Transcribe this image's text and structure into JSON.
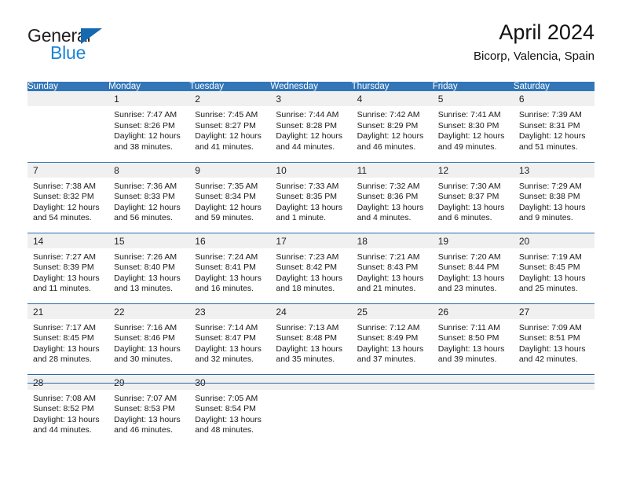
{
  "brand": {
    "name_part1": "General",
    "name_part2": "Blue",
    "triangle_color": "#1469b0",
    "blue_text_color": "#1b84d6"
  },
  "header": {
    "title": "April 2024",
    "subtitle": "Bicorp, Valencia, Spain"
  },
  "theme": {
    "header_bg": "#3276b8",
    "rule_color": "#2b6cad",
    "daynum_band_bg": "#f0f0f0"
  },
  "weekdays": [
    "Sunday",
    "Monday",
    "Tuesday",
    "Wednesday",
    "Thursday",
    "Friday",
    "Saturday"
  ],
  "labels": {
    "sunrise_prefix": "Sunrise:",
    "sunset_prefix": "Sunset:",
    "daylight_prefix": "Daylight:"
  },
  "weeks": [
    [
      {
        "day": "",
        "sunrise": "",
        "sunset": "",
        "daylight_line1": "",
        "daylight_line2": ""
      },
      {
        "day": "1",
        "sunrise": "Sunrise: 7:47 AM",
        "sunset": "Sunset: 8:26 PM",
        "daylight_line1": "Daylight: 12 hours",
        "daylight_line2": "and 38 minutes."
      },
      {
        "day": "2",
        "sunrise": "Sunrise: 7:45 AM",
        "sunset": "Sunset: 8:27 PM",
        "daylight_line1": "Daylight: 12 hours",
        "daylight_line2": "and 41 minutes."
      },
      {
        "day": "3",
        "sunrise": "Sunrise: 7:44 AM",
        "sunset": "Sunset: 8:28 PM",
        "daylight_line1": "Daylight: 12 hours",
        "daylight_line2": "and 44 minutes."
      },
      {
        "day": "4",
        "sunrise": "Sunrise: 7:42 AM",
        "sunset": "Sunset: 8:29 PM",
        "daylight_line1": "Daylight: 12 hours",
        "daylight_line2": "and 46 minutes."
      },
      {
        "day": "5",
        "sunrise": "Sunrise: 7:41 AM",
        "sunset": "Sunset: 8:30 PM",
        "daylight_line1": "Daylight: 12 hours",
        "daylight_line2": "and 49 minutes."
      },
      {
        "day": "6",
        "sunrise": "Sunrise: 7:39 AM",
        "sunset": "Sunset: 8:31 PM",
        "daylight_line1": "Daylight: 12 hours",
        "daylight_line2": "and 51 minutes."
      }
    ],
    [
      {
        "day": "7",
        "sunrise": "Sunrise: 7:38 AM",
        "sunset": "Sunset: 8:32 PM",
        "daylight_line1": "Daylight: 12 hours",
        "daylight_line2": "and 54 minutes."
      },
      {
        "day": "8",
        "sunrise": "Sunrise: 7:36 AM",
        "sunset": "Sunset: 8:33 PM",
        "daylight_line1": "Daylight: 12 hours",
        "daylight_line2": "and 56 minutes."
      },
      {
        "day": "9",
        "sunrise": "Sunrise: 7:35 AM",
        "sunset": "Sunset: 8:34 PM",
        "daylight_line1": "Daylight: 12 hours",
        "daylight_line2": "and 59 minutes."
      },
      {
        "day": "10",
        "sunrise": "Sunrise: 7:33 AM",
        "sunset": "Sunset: 8:35 PM",
        "daylight_line1": "Daylight: 13 hours",
        "daylight_line2": "and 1 minute."
      },
      {
        "day": "11",
        "sunrise": "Sunrise: 7:32 AM",
        "sunset": "Sunset: 8:36 PM",
        "daylight_line1": "Daylight: 13 hours",
        "daylight_line2": "and 4 minutes."
      },
      {
        "day": "12",
        "sunrise": "Sunrise: 7:30 AM",
        "sunset": "Sunset: 8:37 PM",
        "daylight_line1": "Daylight: 13 hours",
        "daylight_line2": "and 6 minutes."
      },
      {
        "day": "13",
        "sunrise": "Sunrise: 7:29 AM",
        "sunset": "Sunset: 8:38 PM",
        "daylight_line1": "Daylight: 13 hours",
        "daylight_line2": "and 9 minutes."
      }
    ],
    [
      {
        "day": "14",
        "sunrise": "Sunrise: 7:27 AM",
        "sunset": "Sunset: 8:39 PM",
        "daylight_line1": "Daylight: 13 hours",
        "daylight_line2": "and 11 minutes."
      },
      {
        "day": "15",
        "sunrise": "Sunrise: 7:26 AM",
        "sunset": "Sunset: 8:40 PM",
        "daylight_line1": "Daylight: 13 hours",
        "daylight_line2": "and 13 minutes."
      },
      {
        "day": "16",
        "sunrise": "Sunrise: 7:24 AM",
        "sunset": "Sunset: 8:41 PM",
        "daylight_line1": "Daylight: 13 hours",
        "daylight_line2": "and 16 minutes."
      },
      {
        "day": "17",
        "sunrise": "Sunrise: 7:23 AM",
        "sunset": "Sunset: 8:42 PM",
        "daylight_line1": "Daylight: 13 hours",
        "daylight_line2": "and 18 minutes."
      },
      {
        "day": "18",
        "sunrise": "Sunrise: 7:21 AM",
        "sunset": "Sunset: 8:43 PM",
        "daylight_line1": "Daylight: 13 hours",
        "daylight_line2": "and 21 minutes."
      },
      {
        "day": "19",
        "sunrise": "Sunrise: 7:20 AM",
        "sunset": "Sunset: 8:44 PM",
        "daylight_line1": "Daylight: 13 hours",
        "daylight_line2": "and 23 minutes."
      },
      {
        "day": "20",
        "sunrise": "Sunrise: 7:19 AM",
        "sunset": "Sunset: 8:45 PM",
        "daylight_line1": "Daylight: 13 hours",
        "daylight_line2": "and 25 minutes."
      }
    ],
    [
      {
        "day": "21",
        "sunrise": "Sunrise: 7:17 AM",
        "sunset": "Sunset: 8:45 PM",
        "daylight_line1": "Daylight: 13 hours",
        "daylight_line2": "and 28 minutes."
      },
      {
        "day": "22",
        "sunrise": "Sunrise: 7:16 AM",
        "sunset": "Sunset: 8:46 PM",
        "daylight_line1": "Daylight: 13 hours",
        "daylight_line2": "and 30 minutes."
      },
      {
        "day": "23",
        "sunrise": "Sunrise: 7:14 AM",
        "sunset": "Sunset: 8:47 PM",
        "daylight_line1": "Daylight: 13 hours",
        "daylight_line2": "and 32 minutes."
      },
      {
        "day": "24",
        "sunrise": "Sunrise: 7:13 AM",
        "sunset": "Sunset: 8:48 PM",
        "daylight_line1": "Daylight: 13 hours",
        "daylight_line2": "and 35 minutes."
      },
      {
        "day": "25",
        "sunrise": "Sunrise: 7:12 AM",
        "sunset": "Sunset: 8:49 PM",
        "daylight_line1": "Daylight: 13 hours",
        "daylight_line2": "and 37 minutes."
      },
      {
        "day": "26",
        "sunrise": "Sunrise: 7:11 AM",
        "sunset": "Sunset: 8:50 PM",
        "daylight_line1": "Daylight: 13 hours",
        "daylight_line2": "and 39 minutes."
      },
      {
        "day": "27",
        "sunrise": "Sunrise: 7:09 AM",
        "sunset": "Sunset: 8:51 PM",
        "daylight_line1": "Daylight: 13 hours",
        "daylight_line2": "and 42 minutes."
      }
    ],
    [
      {
        "day": "28",
        "sunrise": "Sunrise: 7:08 AM",
        "sunset": "Sunset: 8:52 PM",
        "daylight_line1": "Daylight: 13 hours",
        "daylight_line2": "and 44 minutes."
      },
      {
        "day": "29",
        "sunrise": "Sunrise: 7:07 AM",
        "sunset": "Sunset: 8:53 PM",
        "daylight_line1": "Daylight: 13 hours",
        "daylight_line2": "and 46 minutes."
      },
      {
        "day": "30",
        "sunrise": "Sunrise: 7:05 AM",
        "sunset": "Sunset: 8:54 PM",
        "daylight_line1": "Daylight: 13 hours",
        "daylight_line2": "and 48 minutes."
      },
      {
        "day": "",
        "sunrise": "",
        "sunset": "",
        "daylight_line1": "",
        "daylight_line2": ""
      },
      {
        "day": "",
        "sunrise": "",
        "sunset": "",
        "daylight_line1": "",
        "daylight_line2": ""
      },
      {
        "day": "",
        "sunrise": "",
        "sunset": "",
        "daylight_line1": "",
        "daylight_line2": ""
      },
      {
        "day": "",
        "sunrise": "",
        "sunset": "",
        "daylight_line1": "",
        "daylight_line2": ""
      }
    ]
  ]
}
